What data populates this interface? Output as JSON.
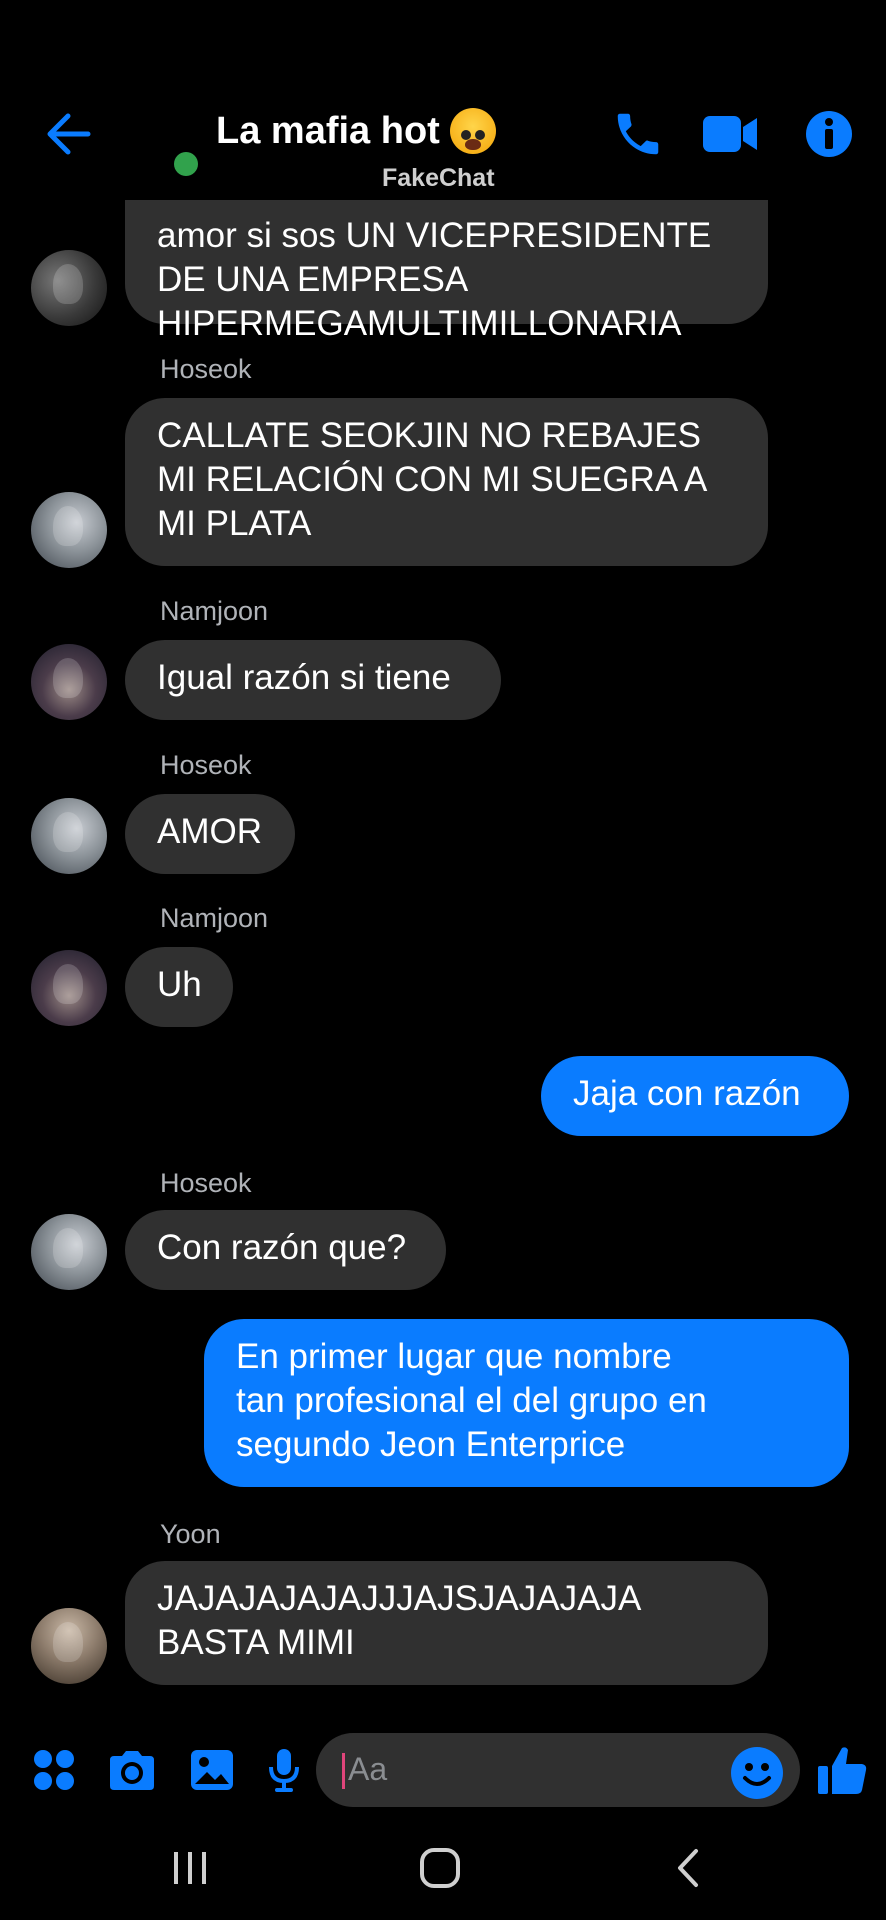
{
  "header": {
    "title": "La mafia hot",
    "watermark": "FakeChat",
    "back_icon": "arrow-left-icon",
    "call_icon": "phone-icon",
    "video_icon": "video-camera-icon",
    "info_icon": "info-icon"
  },
  "colors": {
    "accent": "#0a7cff",
    "bubble_received": "#303030",
    "bubble_sent": "#0a7cff",
    "online": "#31a24c",
    "background": "#000000"
  },
  "messages": [
    {
      "sender": "",
      "text": "amor si sos UN VICEPRESIDENTE\nDE UNA EMPRESA\nHIPERMEGAMULTIMILLONARIA",
      "from_me": false
    },
    {
      "sender": "Hoseok",
      "text": "CALLATE SEOKJIN NO REBAJES\nMI RELACIÓN CON MI SUEGRA A\nMI PLATA",
      "from_me": false
    },
    {
      "sender": "Namjoon",
      "text": "Igual razón si tiene",
      "from_me": false
    },
    {
      "sender": "Hoseok",
      "text": "AMOR",
      "from_me": false
    },
    {
      "sender": "Namjoon",
      "text": "Uh",
      "from_me": false
    },
    {
      "sender": "",
      "text": "Jaja con razón",
      "from_me": true
    },
    {
      "sender": "Hoseok",
      "text": "Con razón que?",
      "from_me": false
    },
    {
      "sender": "",
      "text": "En primer lugar que nombre\ntan profesional el del grupo en\nsegundo Jeon Enterprice",
      "from_me": true
    },
    {
      "sender": "Yoon",
      "text": "JAJAJAJAJAJJJAJSJAJAJAJA\nBASTA MIMI",
      "from_me": false
    }
  ],
  "composer": {
    "placeholder": "Aa",
    "icons": [
      "apps-icon",
      "camera-icon",
      "image-icon",
      "microphone-icon",
      "emoji-icon",
      "thumbs-up-icon"
    ]
  },
  "navbar": {
    "icons": [
      "recent-apps-icon",
      "home-icon",
      "back-icon"
    ]
  }
}
